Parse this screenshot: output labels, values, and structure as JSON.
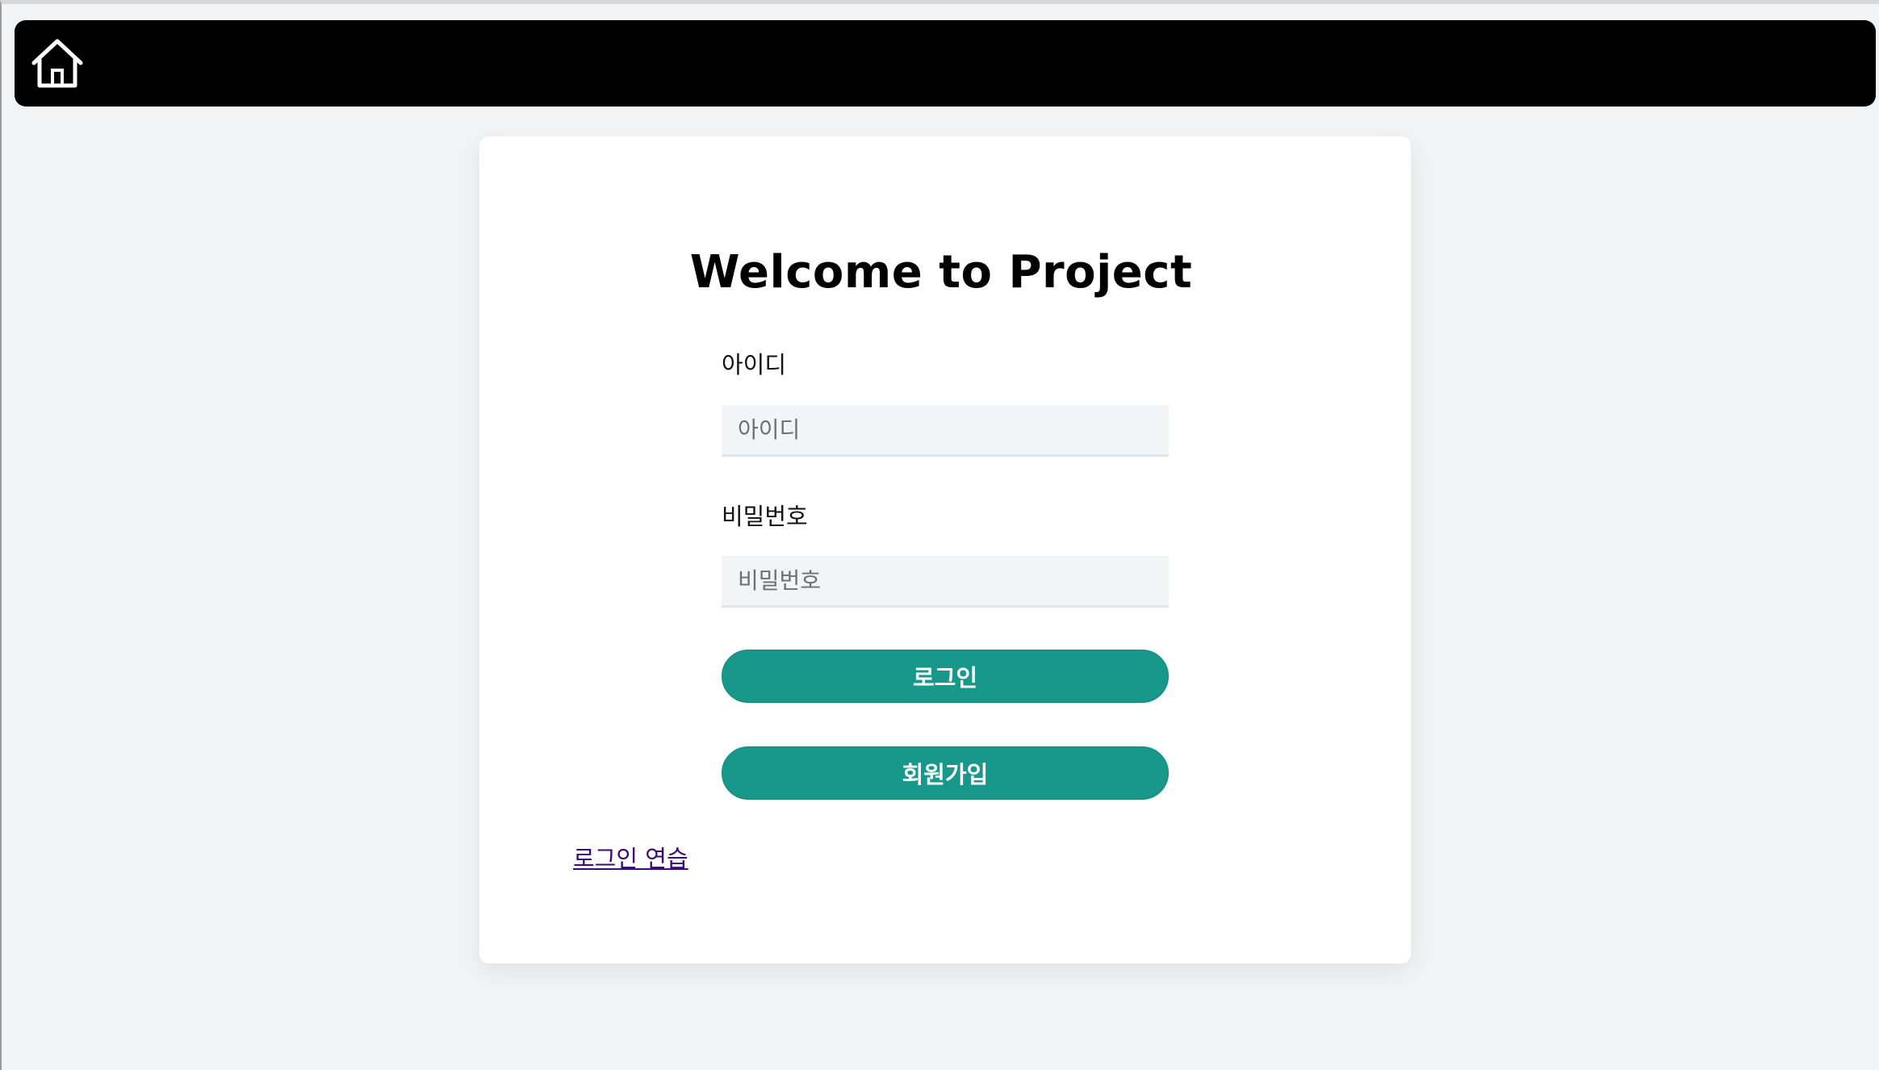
{
  "header": {
    "home_icon": "home-icon",
    "background_color": "#000000"
  },
  "login": {
    "title": "Welcome to Project",
    "id_label": "아이디",
    "id_placeholder": "아이디",
    "password_label": "비밀번호",
    "password_placeholder": "비밀번호",
    "login_button": "로그인",
    "signup_button": "회원가입",
    "practice_link": "로그인 연습",
    "accent_color": "#17988a"
  }
}
